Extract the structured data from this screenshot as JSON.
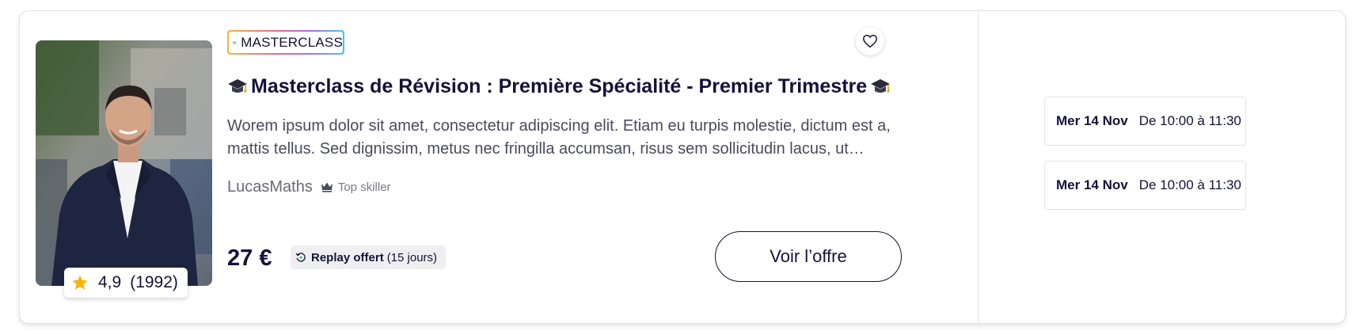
{
  "card": {
    "badge": {
      "label": "MASTERCLASS",
      "icon": "video-camera-icon"
    },
    "favorite": {
      "icon": "heart-icon"
    },
    "title": "Masterclass de Révision : Première Spécialité - Premier Trimestre",
    "title_icon": "graduation-cap-icon",
    "description": "Worem ipsum dolor sit amet, consectetur adipiscing elit. Etiam eu turpis molestie, dictum est a, mattis tellus. Sed dignissim, metus nec fringilla accumsan, risus sem sollicitudin lacus, ut interdum tellus elit sed risus.",
    "author": {
      "name": "LucasMaths",
      "tag": "Top skiller",
      "tag_icon": "crown-icon"
    },
    "rating": {
      "score": "4,9",
      "count": "(1992)",
      "icon": "star-icon"
    },
    "price": "27 €",
    "replay": {
      "label": "Replay offert",
      "detail": "(15 jours)",
      "icon": "replay-icon"
    },
    "cta": "Voir l’offre"
  },
  "slots": [
    {
      "day": "Mer 14 Nov",
      "time": "De 10:00 à 11:30"
    },
    {
      "day": "Mer 14 Nov",
      "time": "De 10:00 à 11:30"
    }
  ],
  "colors": {
    "text": "#14123a",
    "muted": "#4a4a5e",
    "star": "#f7b500",
    "border": "#e3e3e8"
  }
}
